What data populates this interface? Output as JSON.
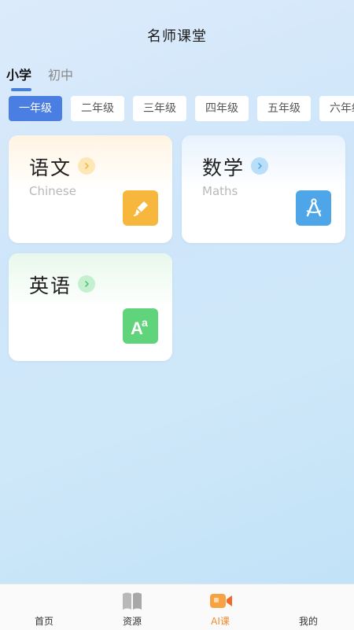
{
  "header": {
    "title": "名师课堂"
  },
  "level_tabs": [
    {
      "label": "小学",
      "active": true
    },
    {
      "label": "初中",
      "active": false
    }
  ],
  "grades": [
    "一年级",
    "二年级",
    "三年级",
    "四年级",
    "五年级",
    "六年级"
  ],
  "selected_grade": "一年级",
  "subjects": [
    {
      "title": "语文",
      "subtitle": "Chinese",
      "icon": "pen-icon",
      "accent": "#f6b73c"
    },
    {
      "title": "数学",
      "subtitle": "Maths",
      "icon": "compass-icon",
      "accent": "#4ea6e8"
    },
    {
      "title": "英语",
      "subtitle": "",
      "icon": "letters-aa-icon",
      "accent": "#5fd47a"
    }
  ],
  "tabbar": [
    {
      "label": "首页",
      "icon": "home-icon"
    },
    {
      "label": "资源",
      "icon": "book-icon"
    },
    {
      "label": "AI课",
      "icon": "video-camera-icon",
      "active": true
    },
    {
      "label": "我的",
      "icon": "profile-icon"
    }
  ],
  "colors": {
    "accent_blue": "#4a7ee3",
    "active_tab": "#f08a32"
  }
}
